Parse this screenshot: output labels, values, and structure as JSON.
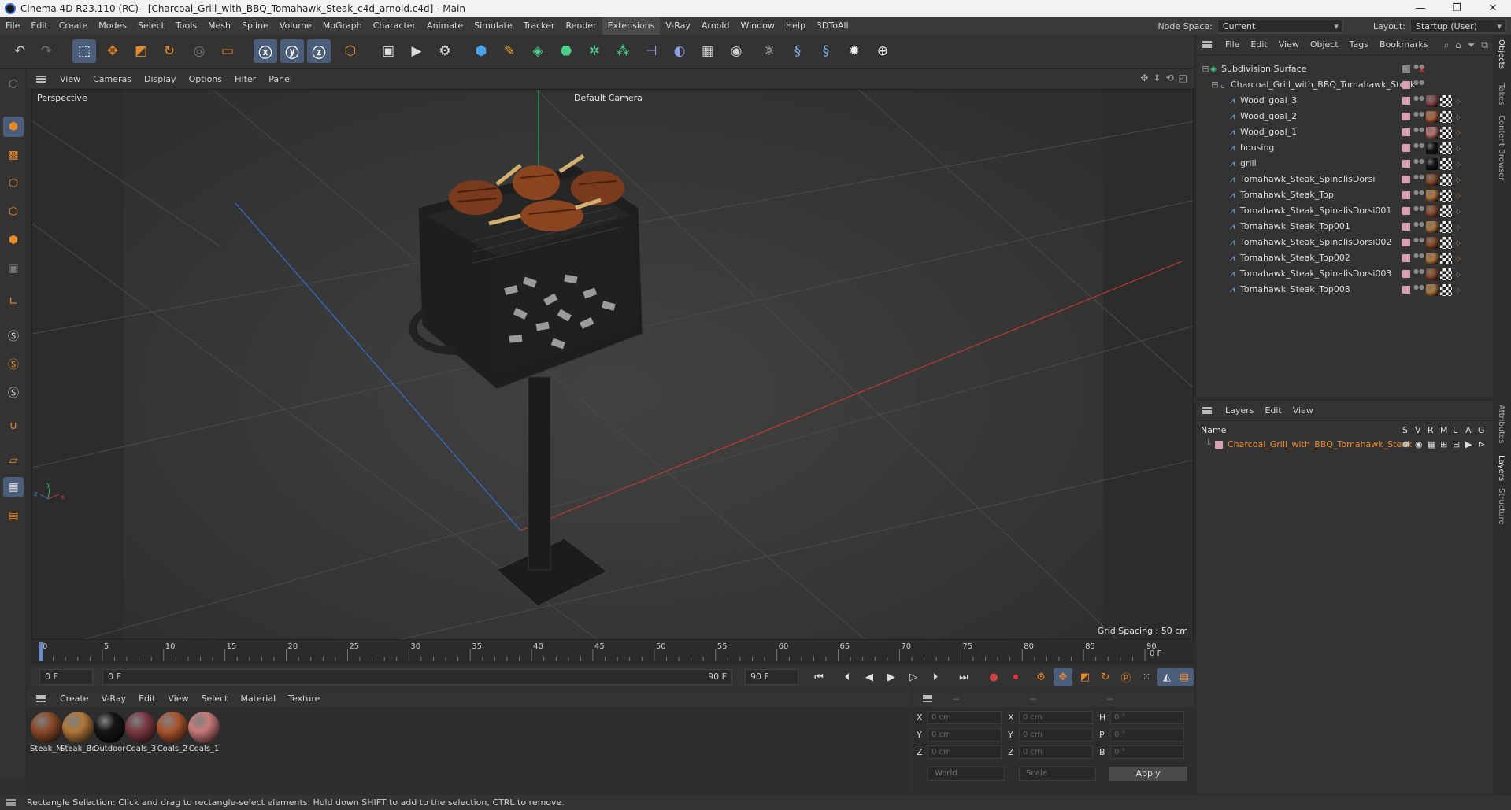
{
  "window": {
    "title": "Cinema 4D R23.110 (RC) - [Charcoal_Grill_with_BBQ_Tomahawk_Steak_c4d_arnold.c4d] - Main",
    "minimize": "—",
    "maximize": "❐",
    "close": "✕"
  },
  "menubar": {
    "items": [
      "File",
      "Edit",
      "Create",
      "Modes",
      "Select",
      "Tools",
      "Mesh",
      "Spline",
      "Volume",
      "MoGraph",
      "Character",
      "Animate",
      "Simulate",
      "Tracker",
      "Render",
      "Extensions",
      "V-Ray",
      "Arnold",
      "Window",
      "Help",
      "3DToAll"
    ],
    "active": "Extensions",
    "node_space_label": "Node Space:",
    "node_space_value": "Current (Standard/Physical)",
    "layout_label": "Layout:",
    "layout_value": "Startup (User)"
  },
  "toolbar": {
    "icons": [
      "undo-icon",
      "redo-icon",
      "live-selection-icon",
      "move-icon",
      "scale-icon",
      "rotate-icon",
      "recent-tool-icon",
      "rect-select-icon",
      "x-axis-icon",
      "y-axis-icon",
      "z-axis-icon",
      "coordinate-system-icon",
      "render-view-icon",
      "render-picture-viewer-icon",
      "render-settings-icon",
      "cube-icon",
      "pen-icon",
      "subdivision-icon",
      "extrude-icon",
      "cloner-icon",
      "mograph-icon",
      "deformer-icon",
      "field-icon",
      "floor-icon",
      "camera-icon",
      "light-icon",
      "python-icon",
      "python2-icon",
      "gear-icon",
      "globe-icon"
    ]
  },
  "viewport": {
    "menu": [
      "View",
      "Cameras",
      "Display",
      "Options",
      "Filter",
      "Panel"
    ],
    "view_name": "Perspective",
    "camera": "Default Camera",
    "grid_spacing": "Grid Spacing : 50 cm"
  },
  "timeline": {
    "ticks": [
      "0",
      "5",
      "10",
      "15",
      "20",
      "25",
      "30",
      "35",
      "40",
      "45",
      "50",
      "55",
      "60",
      "65",
      "70",
      "75",
      "80",
      "85",
      "90"
    ],
    "current_frame": "0 F"
  },
  "anim": {
    "start": "0 F",
    "range_start": "0 F",
    "range_end": "90 F",
    "end": "90 F"
  },
  "materials": {
    "menu": [
      "Create",
      "V-Ray",
      "Edit",
      "View",
      "Select",
      "Material",
      "Texture"
    ],
    "items": [
      {
        "label": "Steak_M",
        "color": "#8a4a2a"
      },
      {
        "label": "Steak_Bc",
        "color": "#b0773a"
      },
      {
        "label": "Outdoor",
        "color": "#151515"
      },
      {
        "label": "Coals_3",
        "color": "#7a3a44"
      },
      {
        "label": "Coals_2",
        "color": "#a8552e"
      },
      {
        "label": "Coals_1",
        "color": "#c87a7a"
      }
    ]
  },
  "attributes": {
    "header_dashes": [
      "--",
      "--",
      "--"
    ],
    "x1": "X",
    "y1": "Y",
    "z1": "Z",
    "x2": "X",
    "y2": "Y",
    "z2": "Z",
    "h": "H",
    "p": "P",
    "b": "B",
    "pos_x": "0 cm",
    "pos_y": "0 cm",
    "pos_z": "0 cm",
    "size_x": "0 cm",
    "size_y": "0 cm",
    "size_z": "0 cm",
    "rot_h": "0 °",
    "rot_p": "0 °",
    "rot_b": "0 °",
    "coord_mode": "World",
    "size_mode": "Scale",
    "apply": "Apply"
  },
  "objects": {
    "menu": [
      "File",
      "Edit",
      "View",
      "Object",
      "Tags",
      "Bookmarks"
    ],
    "items": [
      {
        "name": "Subdivision Surface",
        "level": 0,
        "type": "subdivision"
      },
      {
        "name": "Charcoal_Grill_with_BBQ_Tomahawk_Steak",
        "level": 1,
        "type": "null"
      },
      {
        "name": "Wood_goal_3",
        "level": 2,
        "type": "mesh",
        "mat": "#8a4a4a"
      },
      {
        "name": "Wood_goal_2",
        "level": 2,
        "type": "mesh",
        "mat": "#b0603a"
      },
      {
        "name": "Wood_goal_1",
        "level": 2,
        "type": "mesh",
        "mat": "#c07070"
      },
      {
        "name": "housing",
        "level": 2,
        "type": "mesh",
        "mat": "#151515"
      },
      {
        "name": "grill",
        "level": 2,
        "type": "mesh",
        "mat": "#151515"
      },
      {
        "name": "Tomahawk_Steak_SpinalisDorsi",
        "level": 2,
        "type": "mesh",
        "mat": "#8a4a2a"
      },
      {
        "name": "Tomahawk_Steak_Top",
        "level": 2,
        "type": "mesh",
        "mat": "#b0773a"
      },
      {
        "name": "Tomahawk_Steak_SpinalisDorsi001",
        "level": 2,
        "type": "mesh",
        "mat": "#8a4a2a"
      },
      {
        "name": "Tomahawk_Steak_Top001",
        "level": 2,
        "type": "mesh",
        "mat": "#b0773a"
      },
      {
        "name": "Tomahawk_Steak_SpinalisDorsi002",
        "level": 2,
        "type": "mesh",
        "mat": "#8a4a2a"
      },
      {
        "name": "Tomahawk_Steak_Top002",
        "level": 2,
        "type": "mesh",
        "mat": "#b0773a"
      },
      {
        "name": "Tomahawk_Steak_SpinalisDorsi003",
        "level": 2,
        "type": "mesh",
        "mat": "#8a4a2a"
      },
      {
        "name": "Tomahawk_Steak_Top003",
        "level": 2,
        "type": "mesh",
        "mat": "#b0773a"
      }
    ]
  },
  "layers": {
    "menu": [
      "Layers",
      "Edit",
      "View"
    ],
    "col_name": "Name",
    "col_flags": [
      "S",
      "V",
      "R",
      "M",
      "L",
      "A",
      "G"
    ],
    "row_name": "Charcoal_Grill_with_BBQ_Tomahawk_Steak",
    "row_color": "#e8892b"
  },
  "right_tabs": [
    "Objects",
    "Takes",
    "Content Browser",
    "Attributes",
    "Layers",
    "Structure"
  ],
  "status": "Rectangle Selection: Click and drag to rectangle-select elements. Hold down SHIFT to add to the selection, CTRL to remove.",
  "colors": {
    "accent": "#4a5d7a",
    "orange": "#e8892b",
    "x_axis": "#c0392b",
    "y_axis": "#27ae60",
    "z_axis": "#2e6fd8"
  }
}
